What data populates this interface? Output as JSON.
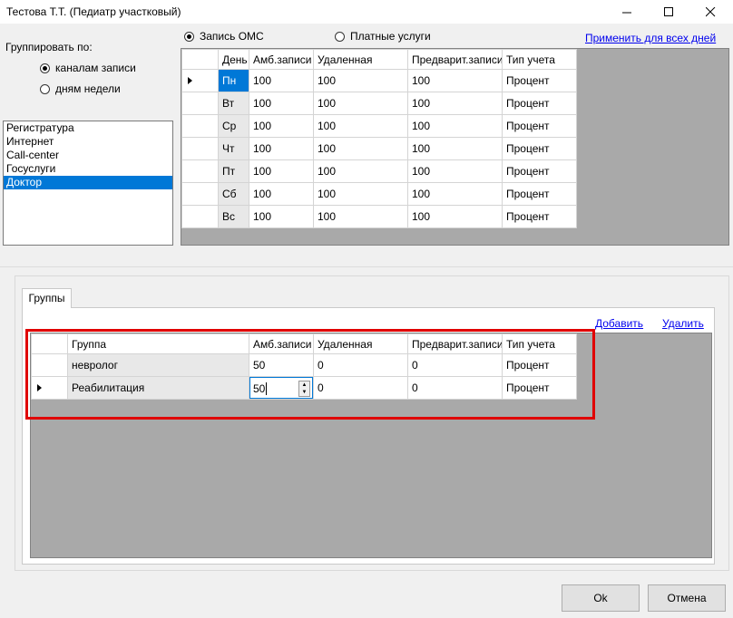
{
  "window": {
    "title": "Тестова Т.Т. (Педиатр участковый)"
  },
  "group_by": {
    "label": "Группировать по:",
    "options": [
      {
        "label": "каналам записи",
        "selected": true
      },
      {
        "label": "дням недели",
        "selected": false
      }
    ]
  },
  "channels": {
    "items": [
      "Регистратура",
      "Интернет",
      "Call-center",
      "Госуслуги",
      "Доктор"
    ],
    "selected_index": 4
  },
  "mode": {
    "options": [
      {
        "label": "Запись ОМС",
        "selected": true
      },
      {
        "label": "Платные услуги",
        "selected": false
      }
    ],
    "apply_all_link": "Применить для всех дней"
  },
  "days_grid": {
    "columns": [
      "День",
      "Амб.записи",
      "Удаленная",
      "Предварит.записи",
      "Тип учета"
    ],
    "rows": [
      {
        "day": "Пн",
        "amb": "100",
        "remote": "100",
        "prelim": "100",
        "type": "Процент",
        "current": true
      },
      {
        "day": "Вт",
        "amb": "100",
        "remote": "100",
        "prelim": "100",
        "type": "Процент"
      },
      {
        "day": "Ср",
        "amb": "100",
        "remote": "100",
        "prelim": "100",
        "type": "Процент"
      },
      {
        "day": "Чт",
        "amb": "100",
        "remote": "100",
        "prelim": "100",
        "type": "Процент"
      },
      {
        "day": "Пт",
        "amb": "100",
        "remote": "100",
        "prelim": "100",
        "type": "Процент"
      },
      {
        "day": "Сб",
        "amb": "100",
        "remote": "100",
        "prelim": "100",
        "type": "Процент"
      },
      {
        "day": "Вс",
        "amb": "100",
        "remote": "100",
        "prelim": "100",
        "type": "Процент"
      }
    ]
  },
  "groups_tab": {
    "tab_label": "Группы",
    "add_link": "Добавить",
    "delete_link": "Удалить",
    "columns": [
      "Группа",
      "Амб.записи",
      "Удаленная",
      "Предварит.записи",
      "Тип учета"
    ],
    "rows": [
      {
        "group": "невролог",
        "amb": "50",
        "remote": "0",
        "prelim": "0",
        "type": "Процент"
      },
      {
        "group": "Реабилитация",
        "amb": "50",
        "remote": "0",
        "prelim": "0",
        "type": "Процент",
        "current": true,
        "editing": true
      }
    ]
  },
  "buttons": {
    "ok": "Ok",
    "cancel": "Отмена"
  },
  "colors": {
    "selection": "#0078d7",
    "highlight": "#e00000",
    "grid_bg": "#a9a9a9"
  }
}
